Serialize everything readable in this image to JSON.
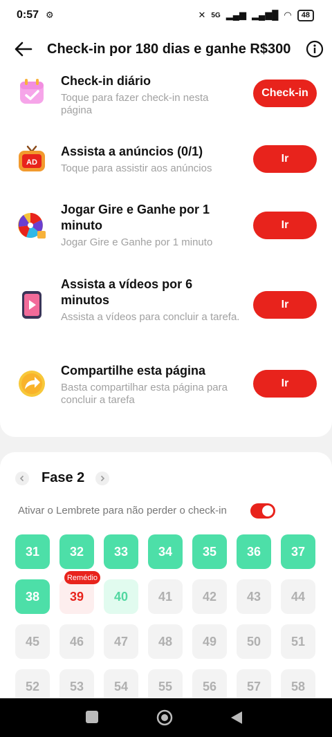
{
  "status": {
    "time": "0:57",
    "network": "5G",
    "battery": "48"
  },
  "header": {
    "title": "Check-in por 180 dias e ganhe R$300"
  },
  "tasks": [
    {
      "title": "Check-in diário",
      "subtitle": "Toque para fazer check-in nesta página",
      "button": "Check-in",
      "icon": "calendar-check-icon"
    },
    {
      "title": "Assista a anúncios  (0/1)",
      "subtitle": "Toque para assistir aos anúncios",
      "button": "Ir",
      "icon": "ad-tv-icon"
    },
    {
      "title": "Jogar Gire e Ganhe por 1 minuto",
      "subtitle": "Jogar Gire e Ganhe por 1 minuto",
      "button": "Ir",
      "icon": "prize-wheel-icon"
    },
    {
      "title": "Assista a vídeos por 6 minutos",
      "subtitle": "Assista a vídeos para concluir a tarefa.",
      "button": "Ir",
      "icon": "video-phone-icon"
    },
    {
      "title": "Compartilhe esta página",
      "subtitle": "Basta compartilhar esta página para concluir a tarefa",
      "button": "Ir",
      "icon": "share-arrow-icon"
    }
  ],
  "phase": {
    "title": "Fase 2",
    "reminder": "Ativar o Lembrete para não perder o check-in",
    "reminder_on": true,
    "badge": "Remédio",
    "days": [
      {
        "n": "31",
        "state": "done"
      },
      {
        "n": "32",
        "state": "done"
      },
      {
        "n": "33",
        "state": "done"
      },
      {
        "n": "34",
        "state": "done"
      },
      {
        "n": "35",
        "state": "done"
      },
      {
        "n": "36",
        "state": "done"
      },
      {
        "n": "37",
        "state": "done"
      },
      {
        "n": "38",
        "state": "done"
      },
      {
        "n": "39",
        "state": "current"
      },
      {
        "n": "40",
        "state": "next"
      },
      {
        "n": "41",
        "state": "future"
      },
      {
        "n": "42",
        "state": "future"
      },
      {
        "n": "43",
        "state": "future"
      },
      {
        "n": "44",
        "state": "future"
      },
      {
        "n": "45",
        "state": "future"
      },
      {
        "n": "46",
        "state": "future"
      },
      {
        "n": "47",
        "state": "future"
      },
      {
        "n": "48",
        "state": "future"
      },
      {
        "n": "49",
        "state": "future"
      },
      {
        "n": "50",
        "state": "future"
      },
      {
        "n": "51",
        "state": "future"
      },
      {
        "n": "52",
        "state": "future"
      },
      {
        "n": "53",
        "state": "future"
      },
      {
        "n": "54",
        "state": "future"
      },
      {
        "n": "55",
        "state": "future"
      },
      {
        "n": "56",
        "state": "future"
      },
      {
        "n": "57",
        "state": "future"
      },
      {
        "n": "58",
        "state": "future"
      }
    ]
  },
  "colors": {
    "accent": "#e8231c",
    "done": "#4ddfa8",
    "next": "#52d7a1"
  }
}
